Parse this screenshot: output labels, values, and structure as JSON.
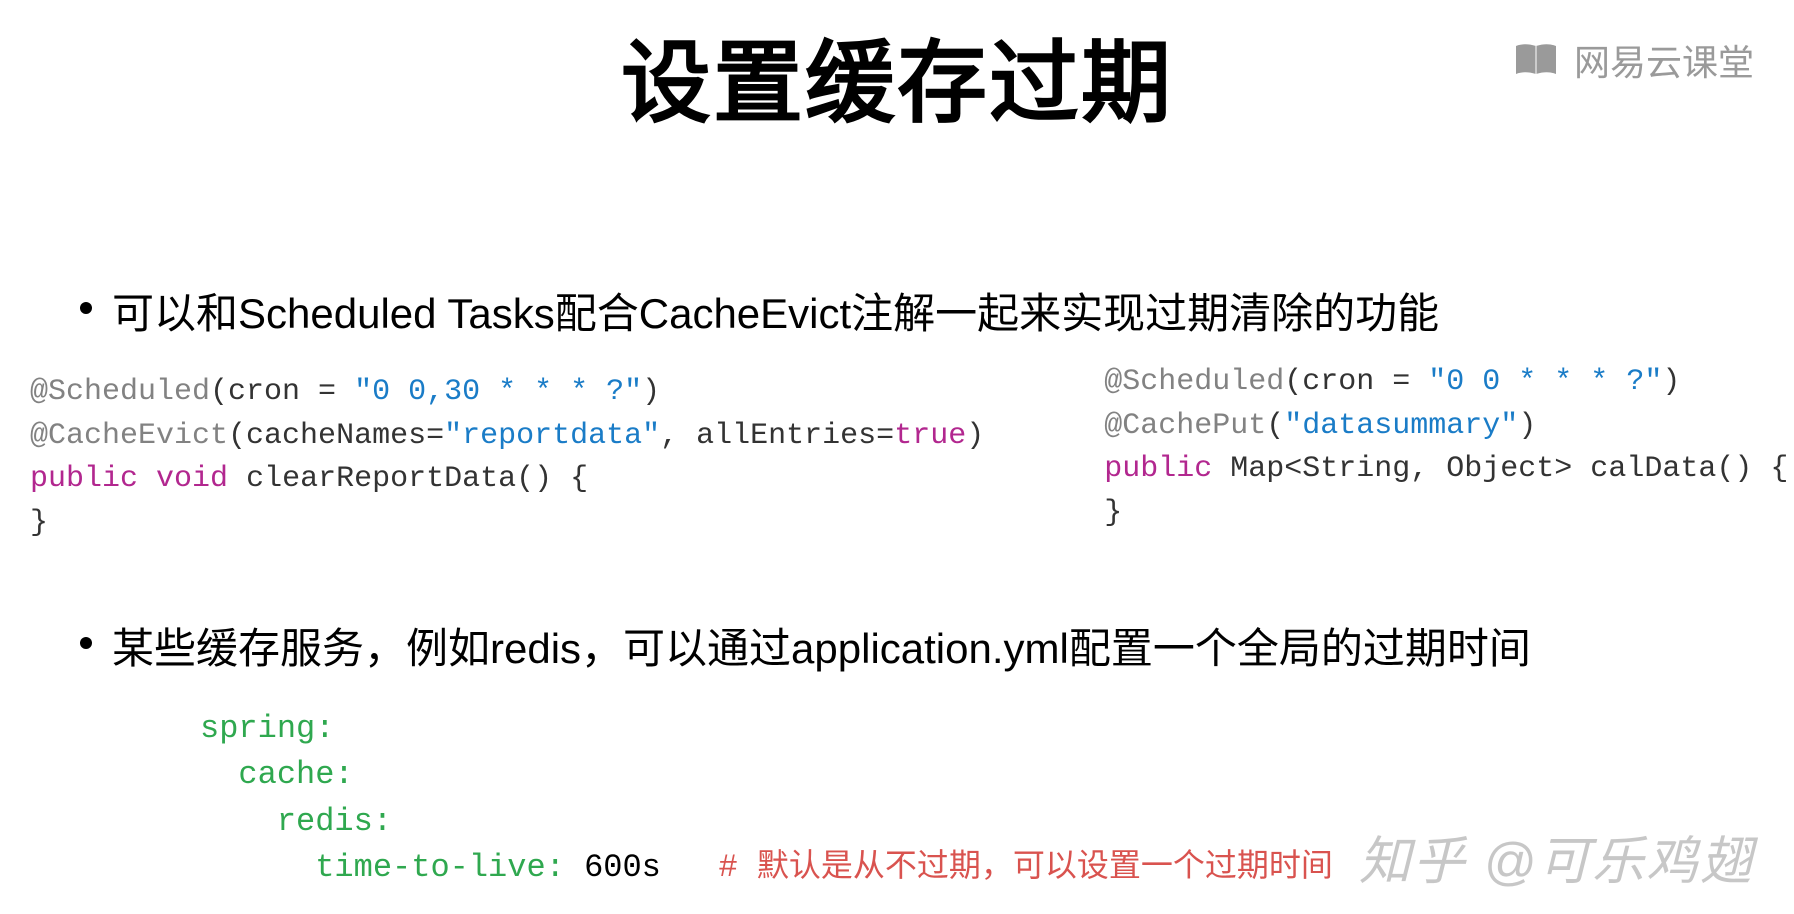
{
  "title": "设置缓存过期",
  "watermark_top": "网易云课堂",
  "bullets": {
    "b1": "可以和Scheduled Tasks配合CacheEvict注解一起来实现过期清除的功能",
    "b2": "某些缓存服务，例如redis，可以通过application.yml配置一个全局的过期时间"
  },
  "code1": {
    "l1_a": "@Scheduled",
    "l1_b": "(cron = ",
    "l1_c": "\"0 0,30 * * * ?\"",
    "l1_d": ")",
    "l2_a": "@CacheEvict",
    "l2_b": "(cacheNames=",
    "l2_c": "\"reportdata\"",
    "l2_d": ", allEntries=",
    "l2_e": "true",
    "l2_f": ")",
    "l3_a": "public",
    "l3_b": " ",
    "l3_c": "void",
    "l3_d": " clearReportData() {",
    "l4": "}"
  },
  "code2": {
    "l1_a": "@Scheduled",
    "l1_b": "(cron = ",
    "l1_c": "\"0 0 * * * ?\"",
    "l1_d": ")",
    "l2_a": "@CachePut",
    "l2_b": "(",
    "l2_c": "\"datasummary\"",
    "l2_d": ")",
    "l3_a": "public",
    "l3_b": " Map<String, Object> calData() {",
    "l4": "}"
  },
  "yaml": {
    "l1": "spring:",
    "l2": "  cache:",
    "l3": "    redis:",
    "l4_a": "      time-to-live:",
    "l4_b": " 600s   ",
    "l4_c": "# 默认是从不过期，可以设置一个过期时间"
  },
  "watermark_bottom": "知乎 @可乐鸡翅"
}
